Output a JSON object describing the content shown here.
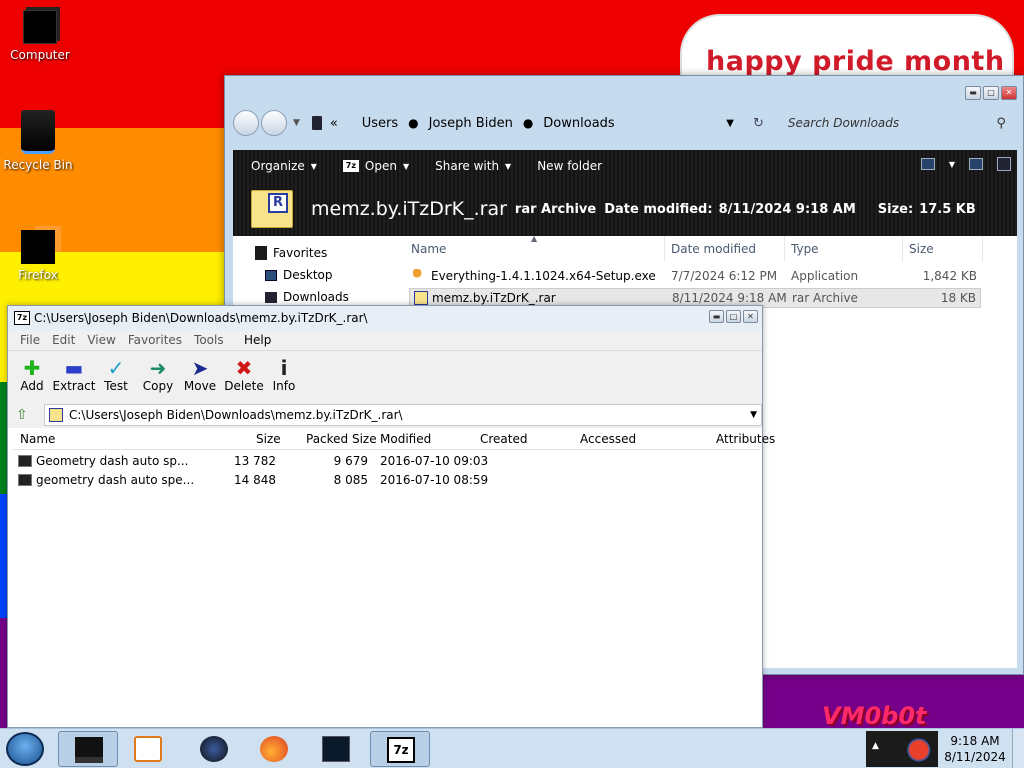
{
  "desktop": {
    "icons": [
      {
        "label": "Computer",
        "icon": "computer-icon"
      },
      {
        "label": "Recycle Bin",
        "icon": "recycle-bin-icon"
      },
      {
        "label": "Firefox",
        "icon": "firefox-icon"
      }
    ],
    "banner_text": "happy pride month",
    "watermark": "VM0b0t",
    "stripe_colors": [
      "#ef0000",
      "#ff8c00",
      "#ffef00",
      "#00811f",
      "#0044ff",
      "#760089"
    ]
  },
  "explorer": {
    "breadcrumb": [
      "Users",
      "Joseph Biden",
      "Downloads"
    ],
    "breadcrumb_prefix": "«",
    "search_placeholder": "Search Downloads",
    "toolbar": {
      "organize": "Organize",
      "open": "Open",
      "share_with": "Share with",
      "new_folder": "New folder"
    },
    "details": {
      "file_name": "memz.by.iTzDrK_.rar",
      "file_type": "rar Archive",
      "modified_label": "Date modified:",
      "modified_value": "8/11/2024 9:18 AM",
      "size_label": "Size:",
      "size_value": "17.5 KB"
    },
    "nav_pane": {
      "favorites": "Favorites",
      "desktop": "Desktop",
      "downloads": "Downloads"
    },
    "columns": [
      "Name",
      "Date modified",
      "Type",
      "Size"
    ],
    "files": [
      {
        "name": "Everything-1.4.1.1024.x64-Setup.exe",
        "modified": "7/7/2024 6:12 PM",
        "type": "Application",
        "size": "1,842 KB",
        "icon": "installer-key-icon"
      },
      {
        "name": "memz.by.iTzDrK_.rar",
        "modified": "8/11/2024 9:18 AM",
        "type": "rar Archive",
        "size": "18 KB",
        "icon": "rar-archive-icon",
        "selected": true
      }
    ]
  },
  "sevenzip": {
    "title": "C:\\Users\\Joseph Biden\\Downloads\\memz.by.iTzDrK_.rar\\",
    "logo_text": "7z",
    "menu": [
      "File",
      "Edit",
      "View",
      "Favorites",
      "Tools",
      "Help"
    ],
    "tools": [
      "Add",
      "Extract",
      "Test",
      "Copy",
      "Move",
      "Delete",
      "Info"
    ],
    "path": "C:\\Users\\Joseph Biden\\Downloads\\memz.by.iTzDrK_.rar\\",
    "columns": [
      "Name",
      "Size",
      "Packed Size",
      "Modified",
      "Created",
      "Accessed",
      "Attributes"
    ],
    "files": [
      {
        "name": "Geometry dash auto sp...",
        "size": "13 782",
        "packed": "9 679",
        "modified": "2016-07-10 09:03"
      },
      {
        "name": "geometry dash auto spe...",
        "size": "14 848",
        "packed": "8 085",
        "modified": "2016-07-10 08:59"
      }
    ]
  },
  "taskbar": {
    "apps": [
      "windows-explorer",
      "media-player",
      "globe-browser",
      "firefox",
      "terminal",
      "7-zip"
    ],
    "time": "9:18 AM",
    "date": "8/11/2024"
  }
}
